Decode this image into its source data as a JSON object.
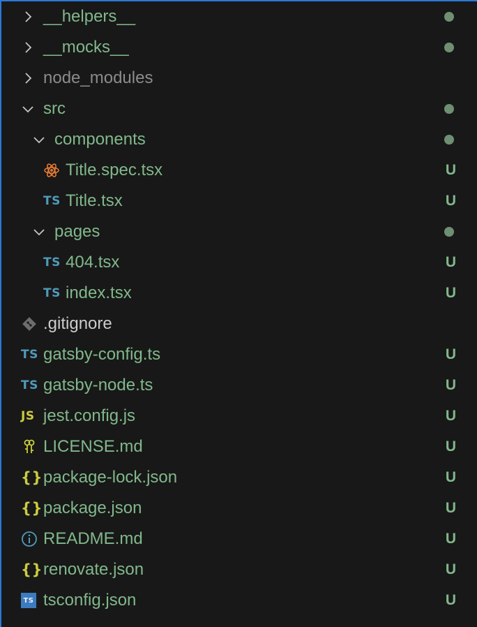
{
  "tree": [
    {
      "label": "__helpers__",
      "kind": "folder",
      "open": false,
      "indent": 0,
      "status": "dot",
      "icon": "chevron-right-icon"
    },
    {
      "label": "__mocks__",
      "kind": "folder",
      "open": false,
      "indent": 0,
      "status": "dot",
      "icon": "chevron-right-icon"
    },
    {
      "label": "node_modules",
      "kind": "folder",
      "open": false,
      "indent": 0,
      "status": "",
      "muted": true,
      "icon": "chevron-right-icon"
    },
    {
      "label": "src",
      "kind": "folder",
      "open": true,
      "indent": 0,
      "status": "dot",
      "icon": "chevron-down-icon"
    },
    {
      "label": "components",
      "kind": "folder",
      "open": true,
      "indent": 1,
      "status": "dot",
      "icon": "chevron-down-icon"
    },
    {
      "label": "Title.spec.tsx",
      "kind": "file",
      "indent": 2,
      "status": "U",
      "icon": "react-icon"
    },
    {
      "label": "Title.tsx",
      "kind": "file",
      "indent": 2,
      "status": "U",
      "icon": "typescript-icon",
      "icon_text": "TS"
    },
    {
      "label": "pages",
      "kind": "folder",
      "open": true,
      "indent": 1,
      "status": "dot",
      "icon": "chevron-down-icon"
    },
    {
      "label": "404.tsx",
      "kind": "file",
      "indent": 2,
      "status": "U",
      "icon": "typescript-icon",
      "icon_text": "TS"
    },
    {
      "label": "index.tsx",
      "kind": "file",
      "indent": 2,
      "status": "U",
      "icon": "typescript-icon",
      "icon_text": "TS"
    },
    {
      "label": ".gitignore",
      "kind": "file",
      "indent": 0,
      "status": "",
      "plain": true,
      "icon": "git-icon"
    },
    {
      "label": "gatsby-config.ts",
      "kind": "file",
      "indent": 0,
      "status": "U",
      "icon": "typescript-icon",
      "icon_text": "TS"
    },
    {
      "label": "gatsby-node.ts",
      "kind": "file",
      "indent": 0,
      "status": "U",
      "icon": "typescript-icon",
      "icon_text": "TS"
    },
    {
      "label": "jest.config.js",
      "kind": "file",
      "indent": 0,
      "status": "U",
      "icon": "javascript-icon",
      "icon_text": "JS"
    },
    {
      "label": "LICENSE.md",
      "kind": "file",
      "indent": 0,
      "status": "U",
      "icon": "license-key-icon"
    },
    {
      "label": "package-lock.json",
      "kind": "file",
      "indent": 0,
      "status": "U",
      "icon": "json-icon",
      "icon_text": "{}"
    },
    {
      "label": "package.json",
      "kind": "file",
      "indent": 0,
      "status": "U",
      "icon": "json-icon",
      "icon_text": "{}"
    },
    {
      "label": "README.md",
      "kind": "file",
      "indent": 0,
      "status": "U",
      "icon": "info-icon"
    },
    {
      "label": "renovate.json",
      "kind": "file",
      "indent": 0,
      "status": "U",
      "icon": "json-icon",
      "icon_text": "{}"
    },
    {
      "label": "tsconfig.json",
      "kind": "file",
      "indent": 0,
      "status": "U",
      "icon": "tsconfig-icon",
      "icon_text": "TS"
    }
  ],
  "colors": {
    "background": "#181818",
    "untracked_green": "#81b88b",
    "muted_gray": "#8b8b8b",
    "typescript_blue": "#519aba",
    "javascript_yellow": "#cbcb41",
    "react_orange": "#e37933",
    "focus_border": "#2b79d6"
  }
}
